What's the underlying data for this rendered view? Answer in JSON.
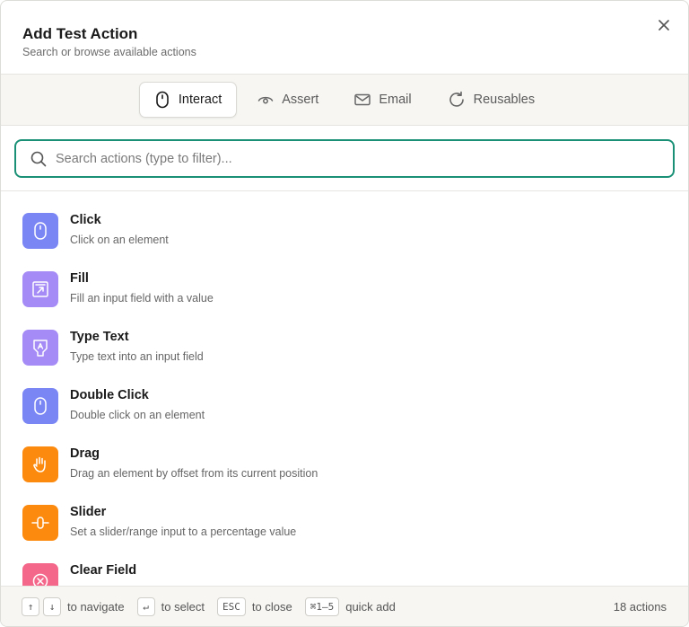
{
  "header": {
    "title": "Add Test Action",
    "subtitle": "Search or browse available actions"
  },
  "tabs": [
    {
      "label": "Interact",
      "icon": "mouse-icon",
      "active": true
    },
    {
      "label": "Assert",
      "icon": "eye-icon",
      "active": false
    },
    {
      "label": "Email",
      "icon": "mail-icon",
      "active": false
    },
    {
      "label": "Reusables",
      "icon": "refresh-icon",
      "active": false
    }
  ],
  "search": {
    "placeholder": "Search actions (type to filter)...",
    "value": ""
  },
  "colors": {
    "accent": "#1a9177",
    "indigo": "#7b86f5",
    "violet": "#a58bf5",
    "orange": "#fb8a0f",
    "pink": "#f5678a"
  },
  "actions": [
    {
      "name": "Click",
      "description": "Click on an element",
      "icon": "mouse-icon",
      "color": "#7b86f5"
    },
    {
      "name": "Fill",
      "description": "Fill an input field with a value",
      "icon": "input-fill-icon",
      "color": "#a58bf5"
    },
    {
      "name": "Type Text",
      "description": "Type text into an input field",
      "icon": "type-text-icon",
      "color": "#a58bf5"
    },
    {
      "name": "Double Click",
      "description": "Double click on an element",
      "icon": "mouse-icon",
      "color": "#7b86f5"
    },
    {
      "name": "Drag",
      "description": "Drag an element by offset from its current position",
      "icon": "hand-icon",
      "color": "#fb8a0f"
    },
    {
      "name": "Slider",
      "description": "Set a slider/range input to a percentage value",
      "icon": "slider-icon",
      "color": "#fb8a0f"
    },
    {
      "name": "Clear Field",
      "description": "",
      "icon": "clear-icon",
      "color": "#f5678a"
    }
  ],
  "footer": {
    "up_key": "↑",
    "down_key": "↓",
    "navigate_label": "to navigate",
    "enter_key": "↵",
    "select_label": "to select",
    "esc_key": "ESC",
    "close_label": "to close",
    "quick_key": "⌘1–5",
    "quick_label": "quick add",
    "count": "18 actions"
  }
}
